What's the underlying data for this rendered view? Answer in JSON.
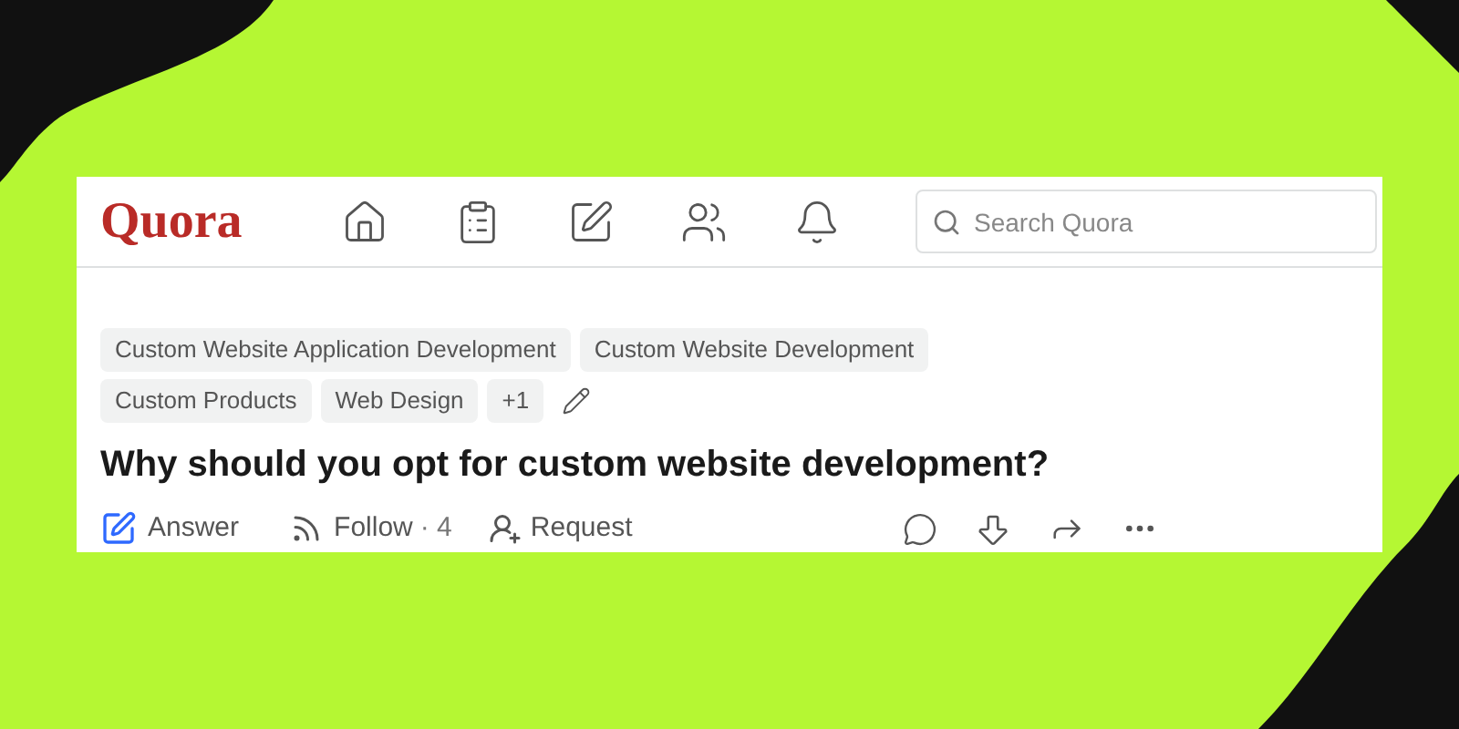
{
  "header": {
    "logo": "Quora",
    "search": {
      "placeholder": "Search Quora"
    }
  },
  "question": {
    "topics": [
      "Custom Website Application Development",
      "Custom Website Development",
      "Custom Products",
      "Web Design"
    ],
    "more_topics": "+1",
    "title": "Why should you opt for custom website development?",
    "actions": {
      "answer": "Answer",
      "follow": "Follow",
      "follow_count": "· 4",
      "request": "Request"
    }
  }
}
